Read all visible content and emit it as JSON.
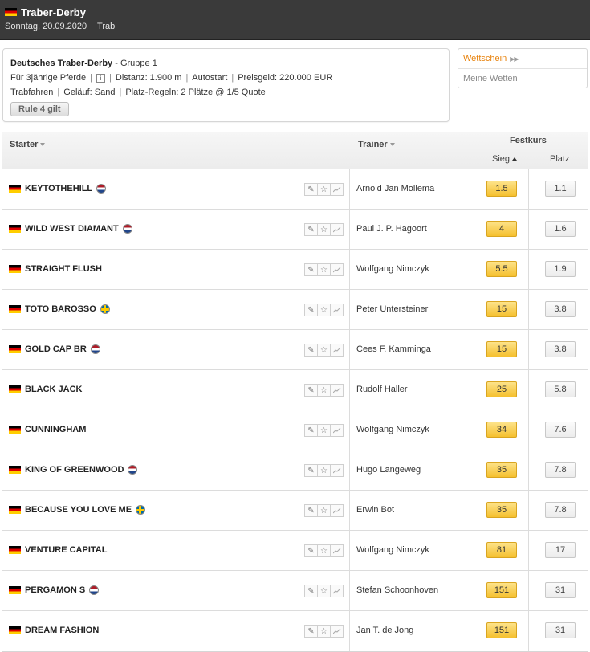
{
  "header": {
    "title": "Traber-Derby",
    "date": "Sonntag, 20.09.2020",
    "type": "Trab"
  },
  "race": {
    "name": "Deutsches Traber-Derby",
    "group": "- Gruppe 1",
    "age": "Für 3jährige Pferde",
    "info_icon": "i",
    "distance": "Distanz: 1.900 m",
    "start": "Autostart",
    "prize": "Preisgeld: 220.000 EUR",
    "mode": "Trabfahren",
    "ground": "Geläuf: Sand",
    "place_rules": "Platz-Regeln: 2 Plätze @ 1/5 Quote",
    "rule_button": "Rule 4 gilt"
  },
  "sidebar": {
    "wettschein": "Wettschein",
    "meine_wetten": "Meine Wetten"
  },
  "table": {
    "col_starter": "Starter",
    "col_trainer": "Trainer",
    "col_festkurs": "Festkurs",
    "col_sieg": "Sieg",
    "col_platz": "Platz",
    "rows": [
      {
        "horse": "KEYTOTHEHILL",
        "flag": "nl",
        "trainer": "Arnold Jan Mollema",
        "sieg": "1.5",
        "platz": "1.1"
      },
      {
        "horse": "WILD WEST DIAMANT",
        "flag": "nl",
        "trainer": "Paul J. P. Hagoort",
        "sieg": "4",
        "platz": "1.6"
      },
      {
        "horse": "STRAIGHT FLUSH",
        "flag": "",
        "trainer": "Wolfgang Nimczyk",
        "sieg": "5.5",
        "platz": "1.9"
      },
      {
        "horse": "TOTO BAROSSO",
        "flag": "se",
        "trainer": "Peter Untersteiner",
        "sieg": "15",
        "platz": "3.8"
      },
      {
        "horse": "GOLD CAP BR",
        "flag": "nl",
        "trainer": "Cees F. Kamminga",
        "sieg": "15",
        "platz": "3.8"
      },
      {
        "horse": "BLACK JACK",
        "flag": "",
        "trainer": "Rudolf Haller",
        "sieg": "25",
        "platz": "5.8"
      },
      {
        "horse": "CUNNINGHAM",
        "flag": "",
        "trainer": "Wolfgang Nimczyk",
        "sieg": "34",
        "platz": "7.6"
      },
      {
        "horse": "KING OF GREENWOOD",
        "flag": "nl",
        "trainer": "Hugo Langeweg",
        "sieg": "35",
        "platz": "7.8"
      },
      {
        "horse": "BECAUSE YOU LOVE ME",
        "flag": "se",
        "trainer": "Erwin Bot",
        "sieg": "35",
        "platz": "7.8"
      },
      {
        "horse": "VENTURE CAPITAL",
        "flag": "",
        "trainer": "Wolfgang Nimczyk",
        "sieg": "81",
        "platz": "17"
      },
      {
        "horse": "PERGAMON S",
        "flag": "nl",
        "trainer": "Stefan Schoonhoven",
        "sieg": "151",
        "platz": "31"
      },
      {
        "horse": "DREAM FASHION",
        "flag": "",
        "trainer": "Jan T. de Jong",
        "sieg": "151",
        "platz": "31"
      }
    ]
  },
  "colors": {
    "accent": "#e8830e",
    "odds_gold": "#f5c02f",
    "header_bg": "#3a3a3a"
  }
}
